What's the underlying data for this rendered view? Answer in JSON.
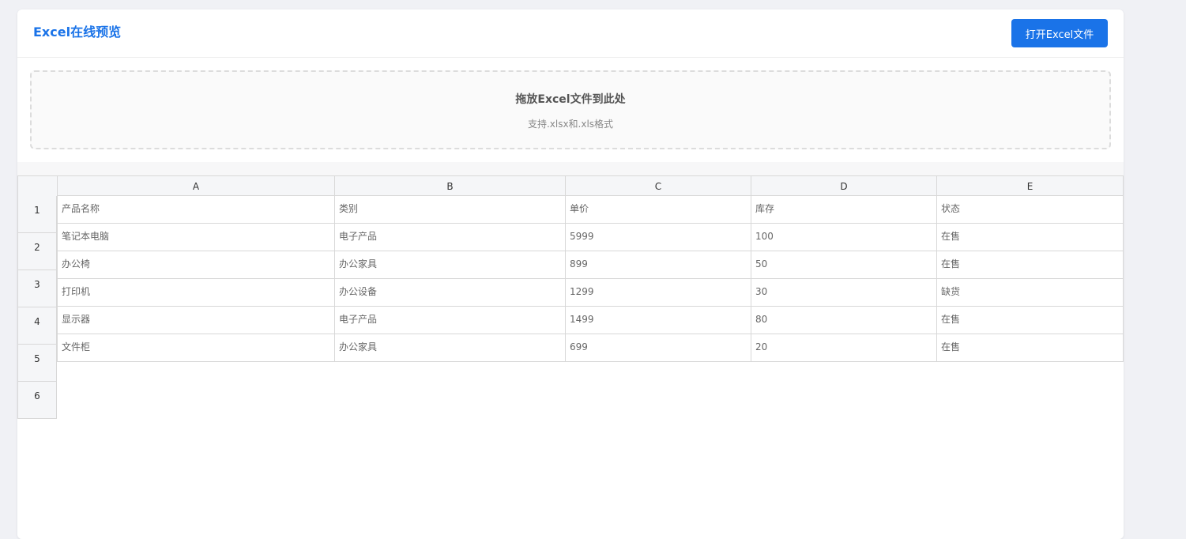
{
  "header": {
    "title": "Excel在线预览",
    "open_button": "打开Excel文件"
  },
  "drop_zone": {
    "title": "拖放Excel文件到此处",
    "subtitle": "支持.xlsx和.xls格式"
  },
  "sheet": {
    "columns": [
      "A",
      "B",
      "C",
      "D",
      "E"
    ],
    "row_numbers": [
      "1",
      "2",
      "3",
      "4",
      "5",
      "6"
    ],
    "rows": [
      [
        "产品名称",
        "类别",
        "单价",
        "库存",
        "状态"
      ],
      [
        "笔记本电脑",
        "电子产品",
        "5999",
        "100",
        "在售"
      ],
      [
        "办公椅",
        "办公家具",
        "899",
        "50",
        "在售"
      ],
      [
        "打印机",
        "办公设备",
        "1299",
        "30",
        "缺货"
      ],
      [
        "显示器",
        "电子产品",
        "1499",
        "80",
        "在售"
      ],
      [
        "文件柜",
        "办公家具",
        "699",
        "20",
        "在售"
      ]
    ]
  },
  "colors": {
    "accent": "#1a73e8",
    "background": "#f0f1f5",
    "header_cell": "#f5f6f8",
    "grid_line": "#d8d8d8"
  }
}
